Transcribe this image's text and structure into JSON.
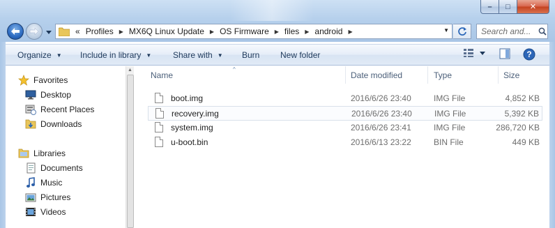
{
  "window": {
    "caption_buttons": {
      "minimize": "–",
      "maximize": "□",
      "close": "✕"
    }
  },
  "nav": {
    "breadcrumbs": [
      "Profiles",
      "MX6Q Linux Update",
      "OS Firmware",
      "files",
      "android"
    ],
    "overflow": "«",
    "search_placeholder": "Search and..."
  },
  "toolbar": {
    "organize": "Organize",
    "include_in_library": "Include in library",
    "share_with": "Share with",
    "burn": "Burn",
    "new_folder": "New folder"
  },
  "sidebar": {
    "favorites_header": "Favorites",
    "favorites": [
      "Desktop",
      "Recent Places",
      "Downloads"
    ],
    "libraries_header": "Libraries",
    "libraries": [
      "Documents",
      "Music",
      "Pictures",
      "Videos"
    ]
  },
  "columns": {
    "name": "Name",
    "date": "Date modified",
    "type": "Type",
    "size": "Size"
  },
  "files": [
    {
      "name": "boot.img",
      "date": "2016/6/26 23:40",
      "type": "IMG File",
      "size": "4,852 KB"
    },
    {
      "name": "recovery.img",
      "date": "2016/6/26 23:40",
      "type": "IMG File",
      "size": "5,392 KB"
    },
    {
      "name": "system.img",
      "date": "2016/6/26 23:41",
      "type": "IMG File",
      "size": "286,720 KB"
    },
    {
      "name": "u-boot.bin",
      "date": "2016/6/13 23:22",
      "type": "BIN File",
      "size": "449 KB"
    }
  ],
  "colors": {
    "accent": "#1e395b",
    "selection_border": "#d9e1ea",
    "frame": "#b6d0ec"
  }
}
